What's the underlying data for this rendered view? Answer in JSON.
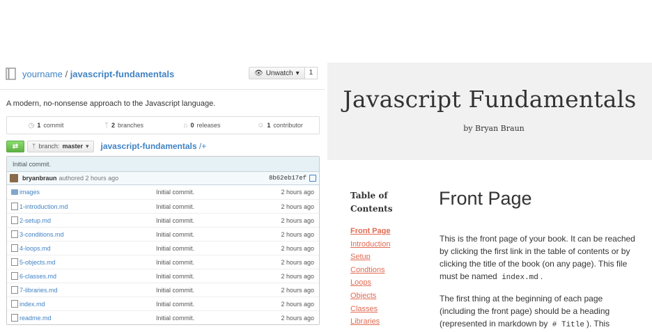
{
  "repo": {
    "owner": "yourname",
    "separator": "/",
    "name": "javascript-fundamentals",
    "watch_label": "Unwatch",
    "watch_count": "1",
    "description": "A modern, no-nonsense approach to the Javascript language.",
    "stats": [
      {
        "count": "1",
        "label": "commit",
        "icon": "clock-icon"
      },
      {
        "count": "2",
        "label": "branches",
        "icon": "branch-icon"
      },
      {
        "count": "0",
        "label": "releases",
        "icon": "tag-icon"
      },
      {
        "count": "1",
        "label": "contributor",
        "icon": "people-icon"
      }
    ],
    "branch_label": "branch:",
    "branch": "master",
    "crumb": "javascript-fundamentals",
    "crumb_suffix": "/+",
    "last_commit": {
      "message": "Initial commit.",
      "author": "bryanbraun",
      "authored": "authored 2 hours ago",
      "sha": "8b62eb17ef"
    },
    "files": [
      {
        "name": "images",
        "type": "folder",
        "message": "Initial commit.",
        "age": "2 hours ago"
      },
      {
        "name": "1-introduction.md",
        "type": "file",
        "message": "Initial commit.",
        "age": "2 hours ago"
      },
      {
        "name": "2-setup.md",
        "type": "file",
        "message": "Initial commit.",
        "age": "2 hours ago"
      },
      {
        "name": "3-conditions.md",
        "type": "file",
        "message": "Initial commit.",
        "age": "2 hours ago"
      },
      {
        "name": "4-loops.md",
        "type": "file",
        "message": "Initial commit.",
        "age": "2 hours ago"
      },
      {
        "name": "5-objects.md",
        "type": "file",
        "message": "Initial commit.",
        "age": "2 hours ago"
      },
      {
        "name": "6-classes.md",
        "type": "file",
        "message": "Initial commit.",
        "age": "2 hours ago"
      },
      {
        "name": "7-libraries.md",
        "type": "file",
        "message": "Initial commit.",
        "age": "2 hours ago"
      },
      {
        "name": "index.md",
        "type": "file",
        "message": "Initial commit.",
        "age": "2 hours ago"
      },
      {
        "name": "readme.md",
        "type": "file",
        "message": "Initial commit.",
        "age": "2 hours ago"
      }
    ]
  },
  "book": {
    "title": "Javascript Fundamentals",
    "author": "by Bryan Braun",
    "toc_heading": "Table of Contents",
    "toc": [
      "Front Page",
      "Introduction",
      "Setup",
      "Condtions",
      "Loops",
      "Objects",
      "Classes",
      "Libraries"
    ],
    "page_title": "Front Page",
    "para1_a": "This is the front page of your book. It can be reached by clicking the first link in the table of contents or by clicking the title of the book (on any page). This file must be named",
    "para1_code": "index.md",
    "para1_b": ".",
    "para2_a": "The first thing at the beginning of each page (including the front page) should be a heading (represented in markdown by",
    "para2_code": "# Title",
    "para2_b": "). This"
  },
  "colors": {
    "link": "#4183c4",
    "toc_link": "#e06a52",
    "hero_bg": "#f1f1f1",
    "compare_green": "#60b044"
  }
}
